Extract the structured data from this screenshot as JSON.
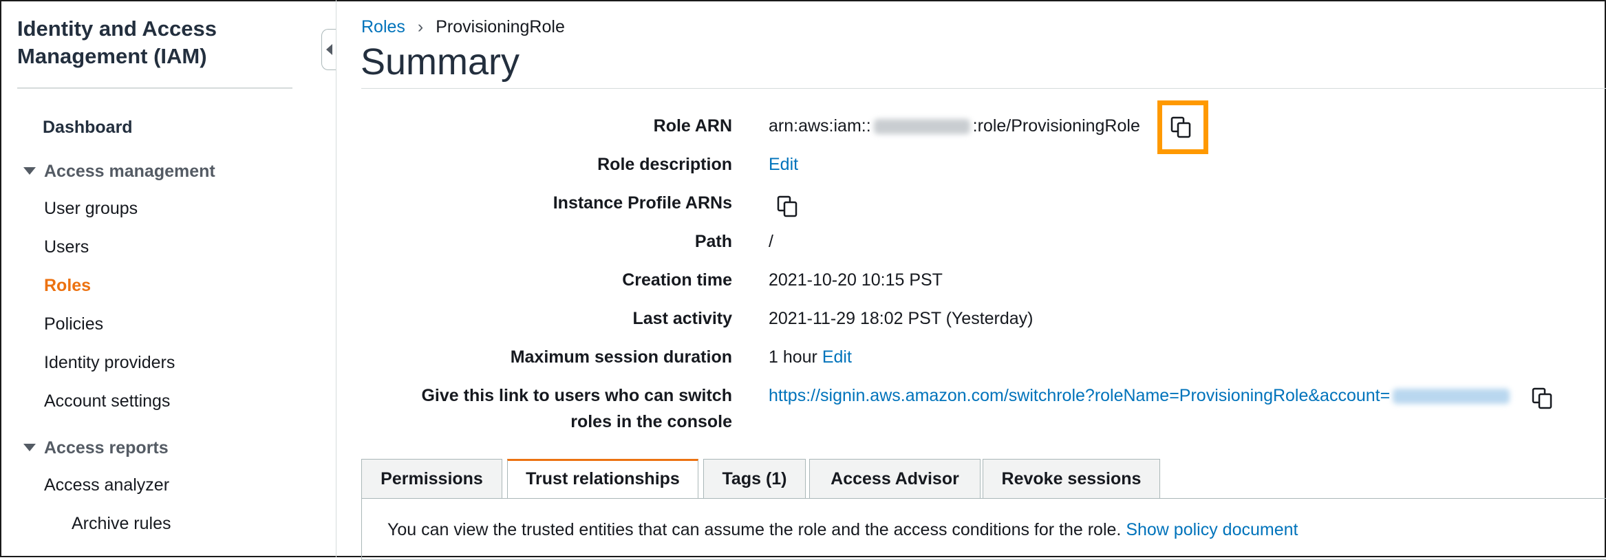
{
  "sidebar": {
    "title": "Identity and Access Management (IAM)",
    "dashboard": "Dashboard",
    "sections": [
      {
        "label": "Access management",
        "items": [
          "User groups",
          "Users",
          "Roles",
          "Policies",
          "Identity providers",
          "Account settings"
        ]
      },
      {
        "label": "Access reports",
        "items": [
          "Access analyzer",
          "Archive rules"
        ]
      }
    ],
    "active_item": "Roles"
  },
  "breadcrumb": {
    "parent": "Roles",
    "current": "ProvisioningRole"
  },
  "page_title": "Summary",
  "summary": {
    "role_arn_label": "Role ARN",
    "role_arn_prefix": "arn:aws:iam::",
    "role_arn_suffix": ":role/ProvisioningRole",
    "role_description_label": "Role description",
    "role_description_action": "Edit",
    "instance_profile_label": "Instance Profile ARNs",
    "path_label": "Path",
    "path_value": "/",
    "creation_time_label": "Creation time",
    "creation_time_value": "2021-10-20 10:15 PST",
    "last_activity_label": "Last activity",
    "last_activity_value": "2021-11-29 18:02 PST (Yesterday)",
    "max_session_label": "Maximum session duration",
    "max_session_value": "1 hour",
    "max_session_action": "Edit",
    "switch_link_label_line1": "Give this link to users who can switch",
    "switch_link_label_line2": "roles in the console",
    "switch_link_value": "https://signin.aws.amazon.com/switchrole?roleName=ProvisioningRole&account="
  },
  "tabs": [
    "Permissions",
    "Trust relationships",
    "Tags (1)",
    "Access Advisor",
    "Revoke sessions"
  ],
  "active_tab": "Trust relationships",
  "trust_panel": {
    "text": "You can view the trusted entities that can assume the role and the access conditions for the role.",
    "link": "Show policy document"
  },
  "colors": {
    "accent": "#ec7211",
    "link": "#0073bb",
    "highlight": "#ff9900"
  }
}
